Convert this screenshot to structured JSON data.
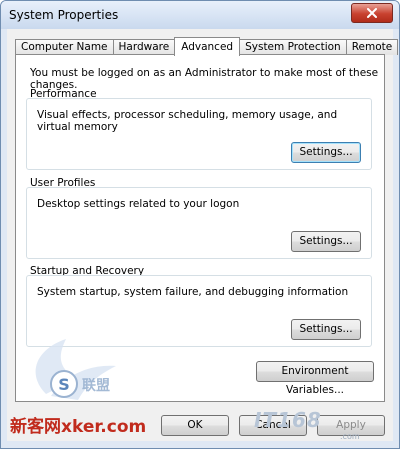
{
  "window": {
    "title": "System Properties"
  },
  "tabs": [
    {
      "label": "Computer Name",
      "active": false
    },
    {
      "label": "Hardware",
      "active": false
    },
    {
      "label": "Advanced",
      "active": true
    },
    {
      "label": "System Protection",
      "active": false
    },
    {
      "label": "Remote",
      "active": false
    }
  ],
  "advanced": {
    "notice": "You must be logged on as an Administrator to make most of these changes.",
    "performance": {
      "label": "Performance",
      "description": "Visual effects, processor scheduling, memory usage, and virtual memory",
      "button": "Settings..."
    },
    "user_profiles": {
      "label": "User Profiles",
      "description": "Desktop settings related to your logon",
      "button": "Settings..."
    },
    "startup_recovery": {
      "label": "Startup and Recovery",
      "description": "System startup, system failure, and debugging information",
      "button": "Settings..."
    },
    "env_button": "Environment Variables..."
  },
  "footer": {
    "ok": "OK",
    "cancel": "Cancel",
    "apply": "Apply"
  },
  "watermarks": {
    "left": "新客网xker.com",
    "left_badge": "S",
    "left_small": "联盟",
    "right": "IT168",
    "right_sub": ".com"
  },
  "colors": {
    "close_red": "#c8412f",
    "focus_blue": "#3c7fb1",
    "watermark_red": "#c12b1d"
  }
}
